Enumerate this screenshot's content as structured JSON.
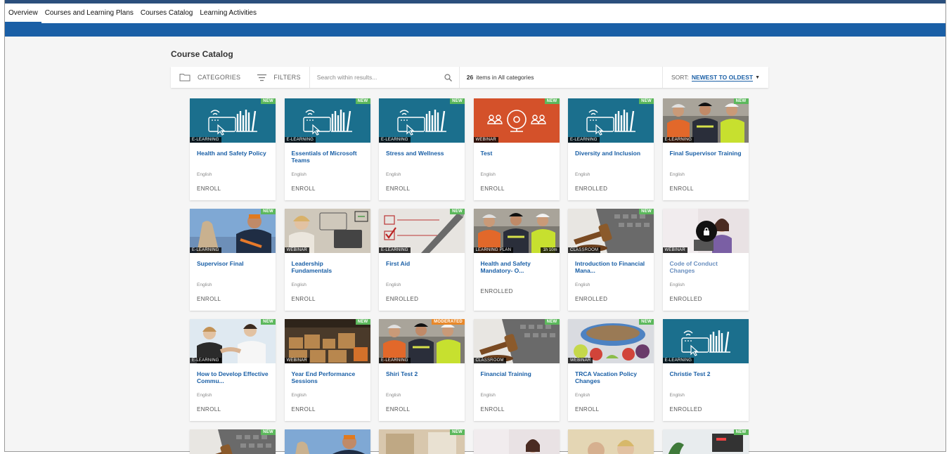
{
  "tabs": [
    "Overview",
    "Courses and Learning Plans",
    "Courses Catalog",
    "Learning Activities"
  ],
  "page_title": "Course Catalog",
  "toolbar": {
    "categories_label": "CATEGORIES",
    "filters_label": "FILTERS",
    "search_placeholder": "Search within results...",
    "count": "26",
    "count_text": "items in All categories",
    "sort_label": "SORT:",
    "sort_value": "NEWEST TO OLDEST"
  },
  "colors": {
    "accent": "#1a5fa6",
    "new_badge": "#5cb85c",
    "moderated_badge": "#e8882a",
    "teal_thumb": "#1b6f8d",
    "orange_thumb": "#d4512a"
  },
  "courses": [
    {
      "title": "Health and Safety Policy",
      "type": "E-LEARNING",
      "badge": "NEW",
      "lang": "English",
      "action": "ENROLL",
      "thumb": "elearning-illustration-teal"
    },
    {
      "title": "Essentials of Microsoft Teams",
      "type": "E-LEARNING",
      "badge": "NEW",
      "lang": "English",
      "action": "ENROLL",
      "thumb": "elearning-illustration-teal"
    },
    {
      "title": "Stress and Wellness",
      "type": "E-LEARNING",
      "badge": "NEW",
      "lang": "English",
      "action": "ENROLL",
      "thumb": "elearning-illustration-teal"
    },
    {
      "title": "Test",
      "type": "WEBINAR",
      "badge": "NEW",
      "lang": "English",
      "action": "ENROLL",
      "thumb": "webinar-illustration-orange"
    },
    {
      "title": "Diversity and Inclusion",
      "type": "E-LEARNING",
      "badge": "NEW",
      "lang": "English",
      "action": "ENROLLED",
      "thumb": "elearning-illustration-teal"
    },
    {
      "title": "Final Supervisor Training",
      "type": "E-LEARNING",
      "badge": "NEW",
      "lang": "English",
      "action": "ENROLL",
      "thumb": "workers-photo"
    },
    {
      "title": "Supervisor Final",
      "type": "E-LEARNING",
      "badge": "NEW",
      "lang": "English",
      "action": "ENROLL",
      "thumb": "worker-glove-photo"
    },
    {
      "title": "Leadership Fundamentals",
      "type": "WEBINAR",
      "badge": "",
      "lang": "English",
      "action": "ENROLL",
      "thumb": "leadership-photo"
    },
    {
      "title": "First Aid",
      "type": "E-LEARNING",
      "badge": "NEW",
      "lang": "English",
      "action": "ENROLLED",
      "thumb": "checklist-photo"
    },
    {
      "title": "Health and Safety Mandatory- O...",
      "type": "LEARNING PLAN",
      "badge": "",
      "duration": "1h 10m",
      "lang": "",
      "action": "ENROLLED",
      "thumb": "workers-photo"
    },
    {
      "title": "Introduction to Financial Mana...",
      "type": "CLASSROOM",
      "badge": "NEW",
      "lang": "English",
      "action": "ENROLLED",
      "thumb": "gavel-keyboard-photo"
    },
    {
      "title": "Code of Conduct Changes",
      "type": "WEBINAR",
      "badge": "",
      "lang": "English",
      "action": "ENROLLED",
      "thumb": "woman-laptop-photo",
      "locked": true
    },
    {
      "title": "How to Develop Effective Commu...",
      "type": "E-LEARNING",
      "badge": "NEW",
      "lang": "English",
      "action": "ENROLL",
      "thumb": "handshake-photo"
    },
    {
      "title": "Year End Performance Sessions",
      "type": "WEBINAR",
      "badge": "NEW",
      "lang": "English",
      "action": "ENROLL",
      "thumb": "warehouse-photo"
    },
    {
      "title": "Shiri Test 2",
      "type": "E-LEARNING",
      "badge": "MODERATED",
      "lang": "English",
      "action": "ENROLL",
      "thumb": "workers-photo"
    },
    {
      "title": "Financial Training",
      "type": "CLASSROOM",
      "badge": "NEW",
      "lang": "English",
      "action": "ENROLL",
      "thumb": "gavel-keyboard-photo"
    },
    {
      "title": "TRCA Vacation Policy Changes",
      "type": "WEBINAR",
      "badge": "NEW",
      "lang": "English",
      "action": "ENROLL",
      "thumb": "food-photo"
    },
    {
      "title": "Christie Test 2",
      "type": "E-LEARNING",
      "badge": "",
      "lang": "English",
      "action": "ENROLLED",
      "thumb": "elearning-illustration-teal"
    },
    {
      "title": "",
      "type": "",
      "badge": "NEW",
      "lang": "",
      "action": "",
      "thumb": "gavel-keyboard-photo"
    },
    {
      "title": "",
      "type": "",
      "badge": "",
      "lang": "",
      "action": "",
      "thumb": "worker-glove-photo"
    },
    {
      "title": "",
      "type": "",
      "badge": "NEW",
      "lang": "",
      "action": "",
      "thumb": "office-photo"
    },
    {
      "title": "",
      "type": "",
      "badge": "",
      "lang": "",
      "action": "",
      "thumb": "woman-laptop-photo"
    },
    {
      "title": "",
      "type": "",
      "badge": "",
      "lang": "",
      "action": "",
      "thumb": "friends-photo"
    },
    {
      "title": "",
      "type": "",
      "badge": "NEW",
      "lang": "",
      "action": "",
      "thumb": "plant-desk-photo"
    }
  ]
}
